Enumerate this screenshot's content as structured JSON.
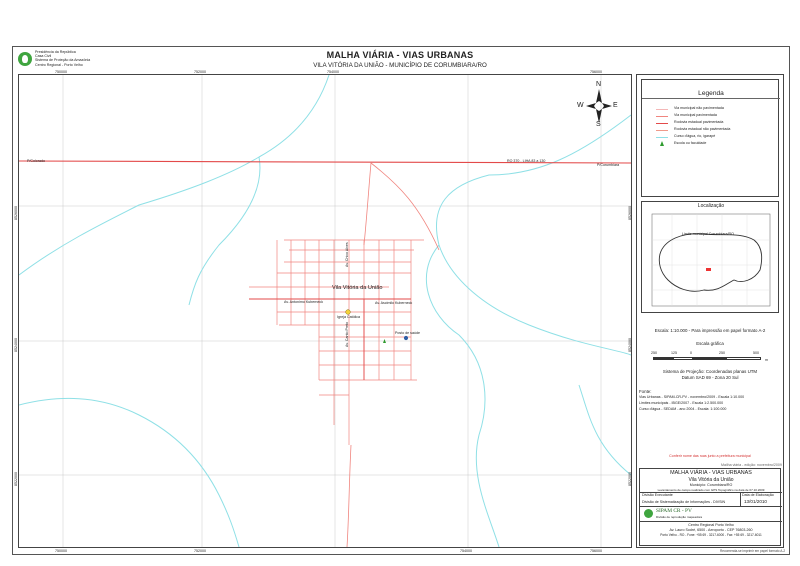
{
  "header": {
    "title": "MALHA VIÁRIA - VIAS URBANAS",
    "subtitle": "VILA VITÓRIA DA UNIÃO -  MUNICÍPIO DE CORUMBIARA/RO",
    "institution_lines": [
      "Presidência da República",
      "Casa Civil",
      "Sistema de Proteção da Amazônia",
      "Centro Regional - Porto Velho"
    ]
  },
  "coords": {
    "top_ticks": [
      "750000",
      "752000",
      "754000",
      "756000"
    ],
    "bottom_ticks": [
      "750000",
      "752000",
      "754000",
      "756000"
    ],
    "left_ticks": [
      "8526000",
      "8524000",
      "8522000"
    ],
    "right_ticks": [
      "8526000",
      "8524000",
      "8522000"
    ]
  },
  "map_labels": {
    "left_road": "P/Colorado",
    "right_road": "P/Corumbiara",
    "road_main": "RO 370 - LIHA 83 a 130",
    "town": "Vila Vitória da União",
    "street_left": "Av. Antonimo Kuberneck",
    "street_right": "Av. Ascimilo Kuberneck",
    "street_v1": "Av. Chico Alves",
    "street_v2": "Av. Canto Preto",
    "church": "Igreja Católica",
    "health": "Posto de saúde"
  },
  "compass": {
    "n": "N",
    "s": "S",
    "e": "E",
    "w": "W"
  },
  "legend": {
    "title": "Legenda",
    "items": [
      {
        "label": "Via municipal não pavimentada",
        "color": "#f4b7b7",
        "type": "line"
      },
      {
        "label": "Via municipal pavimentada",
        "color": "#f0857f",
        "type": "line"
      },
      {
        "label": "Rodovia estadual pavimentada",
        "color": "#e34a4a",
        "type": "line"
      },
      {
        "label": "Rodovia estadual não pavimentada",
        "color": "#ef9a8a",
        "type": "line"
      },
      {
        "label": "Curso d'água, rio, igarapé",
        "color": "#8fe0e6",
        "type": "line"
      },
      {
        "label": "Escola ou faculdade",
        "color": "#2e9b2e",
        "type": "symbol"
      }
    ]
  },
  "location": {
    "title": "Localização",
    "label": "Limite municipal Corumbiara/RO"
  },
  "scale": {
    "text": "Escala: 1:10.000 - Para impressão em papel formato A-2",
    "graphic_title": "Escala gráfica",
    "ticks": [
      "250",
      "125",
      "0",
      "250",
      "500"
    ],
    "unit": "m"
  },
  "projection": {
    "line1": "Sistema de Projeção: Coordenadas planas UTM",
    "line2": "Datum SAD 69 - Zona 20 Sul"
  },
  "sources": {
    "title": "Fonte:",
    "lines": [
      "Vias Urbanas - SIPAM-CR-PV - novembro/2009 - Escala 1:10.000",
      "Limites municipais - IBGE/2007 - Escala 1:2.500.000",
      "Curso d'água - SEDAM - ano 2004 - Escala: 1:100.000"
    ]
  },
  "note": "Conferir nome das ruas junto a prefeitura municipal",
  "title_block": {
    "small_top": "Mailha viária - edição: novembro/2009",
    "t1": "MALHA VIÁRIA - VIAS URBANAS",
    "t2": "Vila Vitória da União",
    "t3": "Município: Corumbiara/RO",
    "t4": "Levantamento de campo realizado com GPS Topográfico na data de 07.10.2009",
    "div_label": "Divisão Executante",
    "div_value": "Divisão de Sistematização de Informações - DIVSIN",
    "date_label": "Data de Elaboração",
    "date_value": "13/01/2010",
    "org_name": "SIPAM CR - PV",
    "org_sub": "Divisão de reprodução mapeadora",
    "addr1": "Centro Regional Porto Velho",
    "addr2": "Av. Lauro Sodré, 6500 - Aeroporto - CEP 76803-260",
    "addr3": "Porto Velho - RO - Fone: +55 69 - 3217-6000 - Fax: +55 69 - 3217-6011"
  },
  "footer_note": "Recomenda-se imprimir em papel formato A-2"
}
